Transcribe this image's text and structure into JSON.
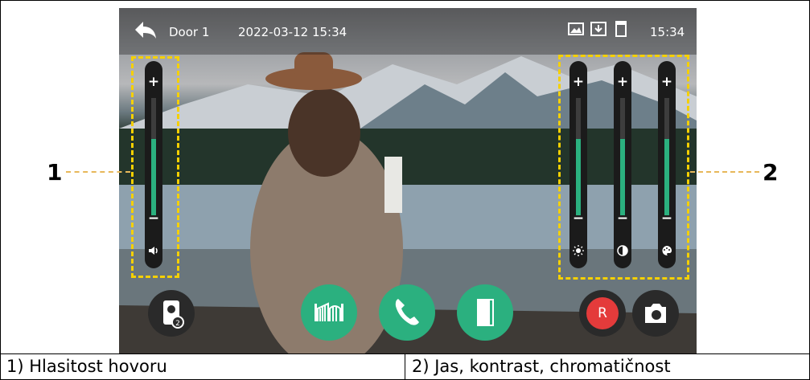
{
  "status_bar": {
    "door": "Door 1",
    "datetime": "2022-03-12 15:34",
    "clock": "15:34",
    "icons": [
      "back-arrow-icon",
      "gallery-icon",
      "download-icon",
      "sd-card-icon"
    ]
  },
  "sliders": {
    "volume": {
      "plus": "+",
      "minus": "−",
      "level": 0.65,
      "icon": "speaker-icon"
    },
    "brightness": {
      "plus": "+",
      "minus": "−",
      "level": 0.65,
      "icon": "sun-icon"
    },
    "contrast": {
      "plus": "+",
      "minus": "−",
      "level": 0.65,
      "icon": "contrast-icon"
    },
    "chroma": {
      "plus": "+",
      "minus": "−",
      "level": 0.65,
      "icon": "palette-icon"
    }
  },
  "callouts": {
    "one": "1",
    "two": "2"
  },
  "buttons": {
    "card": {
      "icon": "monitor-card-icon"
    },
    "gate": {
      "icon": "gate-icon"
    },
    "call": {
      "icon": "phone-icon"
    },
    "door": {
      "icon": "door-icon"
    },
    "record": {
      "label": "R",
      "icon": "record-icon"
    },
    "snapshot": {
      "icon": "camera-icon"
    }
  },
  "captions": {
    "left": "1) Hlasitost hovoru",
    "right": "2) Jas, kontrast, chromatičnost"
  },
  "colors": {
    "accent": "#2bb07f",
    "highlight": "#f5d000",
    "record": "#e43b3b"
  }
}
